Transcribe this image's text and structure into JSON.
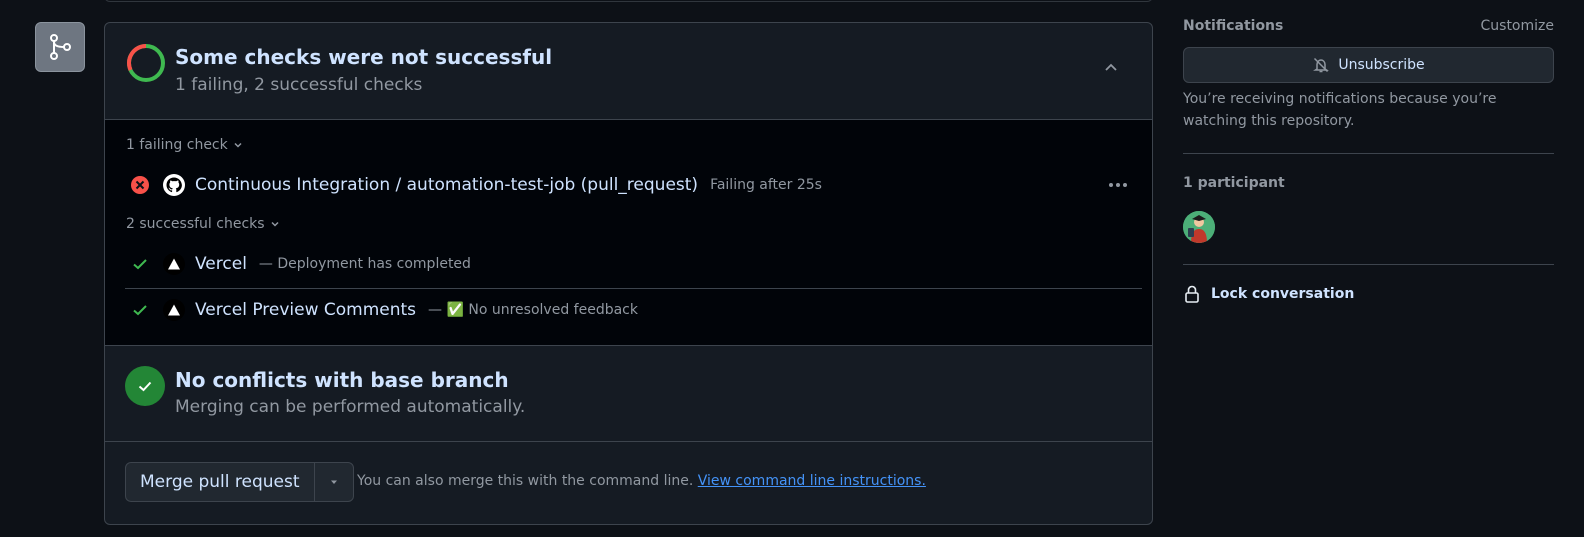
{
  "checks": {
    "title": "Some checks were not successful",
    "summary": "1 failing, 2 successful checks",
    "failing_group_label": "1 failing check",
    "successful_group_label": "2 successful checks",
    "failing": [
      {
        "name": "Continuous Integration / automation-test-job (pull_request)",
        "description": "Failing after 25s"
      }
    ],
    "successful": [
      {
        "name": "Vercel",
        "description": "— Deployment has completed"
      },
      {
        "name": "Vercel Preview Comments",
        "description": "— ✅ No unresolved feedback"
      }
    ]
  },
  "conflicts": {
    "title": "No conflicts with base branch",
    "subtitle": "Merging can be performed automatically."
  },
  "merge": {
    "button_label": "Merge pull request",
    "hint": "You can also merge this with the command line.",
    "link_label": "View command line instructions."
  },
  "sidebar": {
    "notifications_title": "Notifications",
    "customize_label": "Customize",
    "unsubscribe_label": "Unsubscribe",
    "notification_reason": "You’re receiving notifications because you’re watching this repository.",
    "participants_title": "1 participant",
    "lock_label": "Lock conversation"
  },
  "colors": {
    "fail": "#f85149",
    "success": "#3fb950",
    "merge_green": "#238636",
    "link": "#4493f8"
  }
}
